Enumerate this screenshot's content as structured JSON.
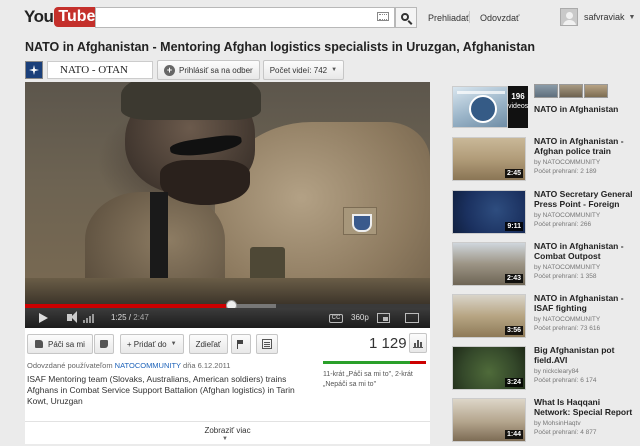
{
  "header": {
    "logo_you": "You",
    "logo_tube": "Tube",
    "search_placeholder": "",
    "nav_browse": "Prehliadať",
    "nav_upload": "Odovzdať",
    "username": "safvraviak"
  },
  "video": {
    "title": "NATO in Afghanistan - Mentoring Afghan logistics specialists in Uruzgan, Afghanistan",
    "channel_name": "NATO - OTAN",
    "subscribe_label": "Prihlásiť sa na odber",
    "videos_count_label": "Počet videí: 742",
    "player": {
      "time_current": "1:25",
      "time_total": "2:47",
      "progress_fraction": 0.509,
      "buffer_fraction": 0.62,
      "quality": "360p",
      "cc_label": "CC"
    },
    "actions": {
      "like_label": "Páči sa mi",
      "add_label": "+ Pridať do",
      "share_label": "Zdieľať"
    },
    "view_count": "1 129",
    "uploader_prefix": "Odovzdané používateľom",
    "uploader_name": "NATOCOMMUNITY",
    "uploader_date": "dňa 6.12.2011",
    "description": "ISAF Mentoring team (Slovaks, Australians, American soldiers) trains Afghans in Combat Service Support Battalion (Afghan logistics) in Tarin Kowt, Uruzgan",
    "likes_text": "11-krát „Páči sa mi to\", 2-krát",
    "dislikes_text": "„Nepáči sa mi to\"",
    "like_fraction": 0.846,
    "show_more": "Zobraziť viac"
  },
  "sidebar": {
    "playlist": {
      "title": "NATO in Afghanistan",
      "count": "196",
      "count_label": "videos"
    },
    "related": [
      {
        "title": "NATO in Afghanistan - Afghan police train",
        "by": "by NATOCOMMUNITY",
        "views": "Počet prehraní: 2 189",
        "duration": "2:45"
      },
      {
        "title": "NATO Secretary General Press Point - Foreign",
        "by": "by NATOCOMMUNITY",
        "views": "Počet prehraní: 266",
        "duration": "9:11"
      },
      {
        "title": "NATO in Afghanistan - Combat Outpost",
        "by": "by NATOCOMMUNITY",
        "views": "Počet prehraní: 1 358",
        "duration": "2:43"
      },
      {
        "title": "NATO in Afghanistan - ISAF fighting",
        "by": "by NATOCOMMUNITY",
        "views": "Počet prehraní: 73 616",
        "duration": "3:56"
      },
      {
        "title": "Big Afghanistan pot field.AVI",
        "by": "by nickcleary84",
        "views": "Počet prehraní: 6 174",
        "duration": "3:24"
      },
      {
        "title": "What Is Haqqani Network: Special Report",
        "by": "by MohsinHaqtv",
        "views": "Počet prehraní: 4 877",
        "duration": "1:44"
      }
    ]
  },
  "colors": {
    "brand_red": "#c4302b",
    "link_blue": "#1c62b9",
    "progress_red": "#cc0000",
    "like_green": "#2aa02a"
  }
}
